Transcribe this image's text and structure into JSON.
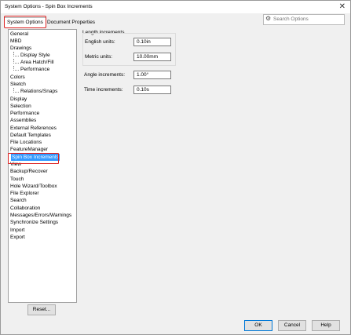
{
  "window": {
    "title": "System Options - Spin Box Increments"
  },
  "tabs": [
    {
      "label": "System Options"
    },
    {
      "label": "Document Properties"
    }
  ],
  "search": {
    "placeholder": "Search Options"
  },
  "tree": {
    "items": [
      {
        "label": "General"
      },
      {
        "label": "MBD"
      },
      {
        "label": "Drawings"
      },
      {
        "label": "Display Style"
      },
      {
        "label": "Area Hatch/Fill"
      },
      {
        "label": "Performance"
      },
      {
        "label": "Colors"
      },
      {
        "label": "Sketch"
      },
      {
        "label": "Relations/Snaps"
      },
      {
        "label": "Display"
      },
      {
        "label": "Selection"
      },
      {
        "label": "Performance"
      },
      {
        "label": "Assemblies"
      },
      {
        "label": "External References"
      },
      {
        "label": "Default Templates"
      },
      {
        "label": "File Locations"
      },
      {
        "label": "FeatureManager"
      },
      {
        "label": "Spin Box Increments"
      },
      {
        "label": "View"
      },
      {
        "label": "Backup/Recover"
      },
      {
        "label": "Touch"
      },
      {
        "label": "Hole Wizard/Toolbox"
      },
      {
        "label": "File Explorer"
      },
      {
        "label": "Search"
      },
      {
        "label": "Collaboration"
      },
      {
        "label": "Messages/Errors/Warnings"
      },
      {
        "label": "Synchronize Settings"
      },
      {
        "label": "Import"
      },
      {
        "label": "Export"
      }
    ]
  },
  "settings": {
    "length_group_label": "Length increments",
    "english_label": "English units:",
    "english_value": "0.10in",
    "metric_label": "Metric units:",
    "metric_value": "10.00mm",
    "angle_label": "Angle increments:",
    "angle_value": "1.00°",
    "time_label": "Time increments:",
    "time_value": "0.10s"
  },
  "buttons": {
    "reset": "Reset...",
    "ok": "OK",
    "cancel": "Cancel",
    "help": "Help"
  },
  "colors": {
    "selection": "#3399ff",
    "highlight_box": "#dd2222"
  }
}
